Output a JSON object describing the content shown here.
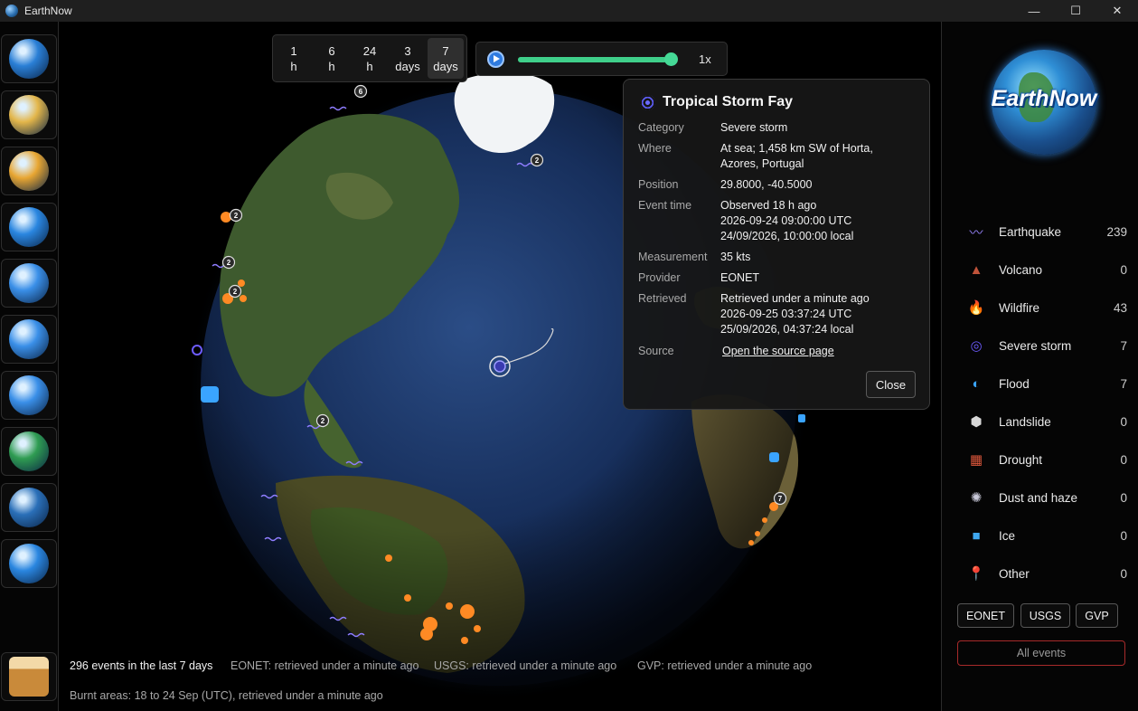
{
  "window": {
    "title": "EarthNow",
    "minimize": "—",
    "maximize": "☐",
    "close": "✕"
  },
  "toolbar": {
    "tools": [
      {
        "name": "rotate-globe-icon",
        "color": "#2a7fd6"
      },
      {
        "name": "weather-icon",
        "color": "#e3b64a"
      },
      {
        "name": "day-night-icon",
        "color": "#e8a632"
      },
      {
        "name": "fit-view-icon",
        "color": "#2a86e0"
      },
      {
        "name": "zoom-in-icon",
        "color": "#3a8fe8"
      },
      {
        "name": "zoom-out-icon",
        "color": "#3a8fe8"
      },
      {
        "name": "refresh-icon",
        "color": "#3a8fe8"
      },
      {
        "name": "globe-check-icon",
        "color": "#2f9c52"
      },
      {
        "name": "settings-gear-icon",
        "color": "#2a6fb8"
      },
      {
        "name": "info-orbit-icon",
        "color": "#2a86e0"
      }
    ],
    "coffee": {
      "name": "coffee-icon",
      "color": "#c98a3a"
    }
  },
  "time_range": {
    "options": [
      {
        "line1": "1",
        "line2": "h"
      },
      {
        "line1": "6",
        "line2": "h"
      },
      {
        "line1": "24",
        "line2": "h"
      },
      {
        "line1": "3",
        "line2": "days"
      },
      {
        "line1": "7",
        "line2": "days"
      }
    ],
    "selected": "7 days"
  },
  "playback": {
    "speed": "1x",
    "progress": 0.93
  },
  "popup": {
    "title": "Tropical Storm Fay",
    "rows": [
      {
        "key": "Category",
        "value": "Severe storm"
      },
      {
        "key": "Where",
        "value": "At sea; 1,458 km SW of Horta,\nAzores, Portugal"
      },
      {
        "key": "Position",
        "value": "29.8000, -40.5000"
      },
      {
        "key": "Event time",
        "value": "Observed 18 h ago\n2026-09-24 09:00:00 UTC\n24/09/2026, 10:00:00 local"
      },
      {
        "key": "Measurement",
        "value": "35 kts"
      },
      {
        "key": "Provider",
        "value": "EONET"
      },
      {
        "key": "Retrieved",
        "value": "Retrieved under a minute ago\n2026-09-25 03:37:24 UTC\n25/09/2026, 04:37:24 local"
      }
    ],
    "source_key": "Source",
    "source_link": "Open the source page",
    "close_label": "Close"
  },
  "globe": {
    "cluster_badges": [
      "6",
      "2",
      "2",
      "2",
      "2",
      "2",
      "7"
    ]
  },
  "status": {
    "event_count": "296 events in the last 7 days",
    "eonet": "EONET: retrieved under a minute ago",
    "usgs": "USGS: retrieved under a minute ago",
    "gvp": "GVP: retrieved under a minute ago",
    "burnt": "Burnt areas: 18 to 24 Sep (UTC), retrieved under a minute ago"
  },
  "logo": {
    "wordmark": "EarthNow"
  },
  "categories": [
    {
      "name": "Earthquake",
      "count": "239",
      "icon": "earthquake-wave-icon",
      "glyph": "〰",
      "color": "#9a86ff"
    },
    {
      "name": "Volcano",
      "count": "0",
      "icon": "volcano-icon",
      "glyph": "▲",
      "color": "#c0533a"
    },
    {
      "name": "Wildfire",
      "count": "43",
      "icon": "wildfire-flame-icon",
      "glyph": "🔥",
      "color": "#f07a1e"
    },
    {
      "name": "Severe storm",
      "count": "7",
      "icon": "storm-spiral-icon",
      "glyph": "◎",
      "color": "#6d5cff"
    },
    {
      "name": "Flood",
      "count": "7",
      "icon": "flood-wave-icon",
      "glyph": "◐",
      "color": "#3aa4ff"
    },
    {
      "name": "Landslide",
      "count": "0",
      "icon": "landslide-rock-icon",
      "glyph": "⬢",
      "color": "#d8d8d8"
    },
    {
      "name": "Drought",
      "count": "0",
      "icon": "drought-icon",
      "glyph": "▦",
      "color": "#d9553a"
    },
    {
      "name": "Dust and haze",
      "count": "0",
      "icon": "dust-haze-icon",
      "glyph": "✺",
      "color": "#c9c9d9"
    },
    {
      "name": "Ice",
      "count": "0",
      "icon": "ice-cube-icon",
      "glyph": "■",
      "color": "#3fa8f0"
    },
    {
      "name": "Other",
      "count": "0",
      "icon": "pin-icon",
      "glyph": "📍",
      "color": "#e04a6a"
    }
  ],
  "providers": [
    "EONET",
    "USGS",
    "GVP"
  ],
  "all_events_label": "All events"
}
